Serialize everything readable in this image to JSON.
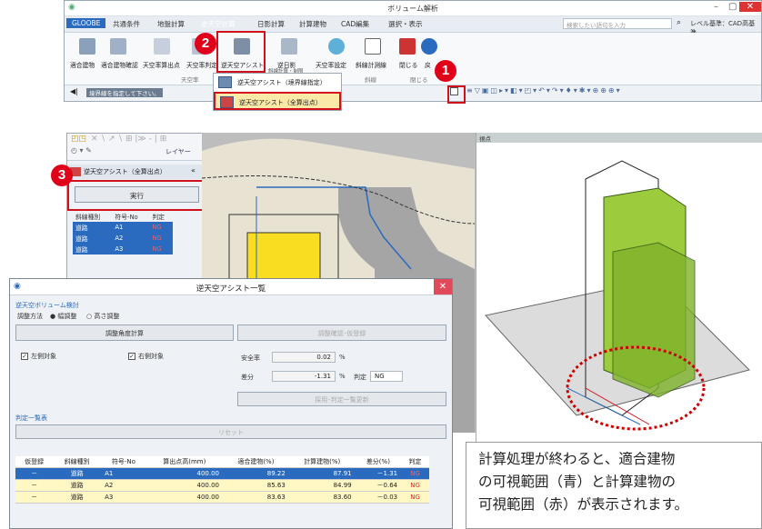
{
  "window": {
    "title": "ボリューム解析",
    "menus": [
      "GLOOBE",
      "共通条件",
      "地盤計算",
      "逆天空計算",
      "日影計算",
      "計算建物",
      "CAD編集",
      "選択・表示"
    ],
    "search_placeholder": "検索したい語句を入力",
    "level_label": "レベル基準：CAD高基準",
    "status_text": "境界線を指定して下さい。"
  },
  "ribbon": {
    "buttons": [
      "適合建物",
      "適合建物確認",
      "天空率算出点",
      "天空率判定",
      "逆天空アシスト",
      "逆日影",
      "天空率設定",
      "斜線計測線",
      "閉じる",
      "戻"
    ],
    "button_sub": "斜線計算・制限",
    "groups": [
      "天空率",
      "斜線",
      "閉じる"
    ]
  },
  "dropdown": {
    "items": [
      "逆天空アシスト（境界線指定）",
      "逆天空アシスト（全算出点）"
    ]
  },
  "badges": {
    "b1": "1",
    "b2": "2",
    "b3": "3"
  },
  "panel": {
    "layer_label": "レイヤー",
    "header": "逆天空アシスト（全算出点）",
    "exec_label": "実行",
    "columns": [
      "斜線種別",
      "符号-No",
      "判定"
    ],
    "rows": [
      [
        "道路",
        "A1",
        "NG"
      ],
      [
        "道路",
        "A2",
        "NG"
      ],
      [
        "道路",
        "A3",
        "NG"
      ]
    ]
  },
  "view2": {
    "title": "視点"
  },
  "dialog": {
    "title": "逆天空アシスト一覧",
    "section1": "逆天空ボリューム検討",
    "adjust_label": "調整方法",
    "opt_width": "幅調整",
    "opt_height": "高さ調整",
    "angle_calc": "調整角度計算",
    "confirm_register": "調整確認･仮登録",
    "left_target": "左側対象",
    "right_target": "右側対象",
    "safety_label": "安全率",
    "safety_value": "0.02",
    "safety_unit": "%",
    "diff_label": "差分",
    "diff_value": "-1.31",
    "diff_unit": "%",
    "judge_label": "判定",
    "judge_value": "NG",
    "update_btn": "採用･判定一覧更新",
    "list_title": "判定一覧表",
    "reset_btn": "リセット",
    "table_headers": [
      "仮登録",
      "斜線種別",
      "符号-No",
      "算出点高(mm)",
      "適合建物(%)",
      "計算建物(%)",
      "差分(%)",
      "判定"
    ],
    "table_rows": [
      [
        "－",
        "道路",
        "A1",
        "400.00",
        "89.22",
        "87.91",
        "－1.31",
        "NG"
      ],
      [
        "－",
        "道路",
        "A2",
        "400.00",
        "85.63",
        "84.99",
        "－0.64",
        "NG"
      ],
      [
        "－",
        "道路",
        "A3",
        "400.00",
        "83.63",
        "83.60",
        "－0.03",
        "NG"
      ]
    ]
  },
  "caption": {
    "lines": [
      "計算処理が終わると、適合建物",
      "の可視範囲（青）と計算建物の",
      "可視範囲（赤）が表示されます。"
    ]
  },
  "colors": {
    "accent": "#2a6bbf",
    "callout": "#e10019",
    "highlight": "#fbe9a8"
  }
}
